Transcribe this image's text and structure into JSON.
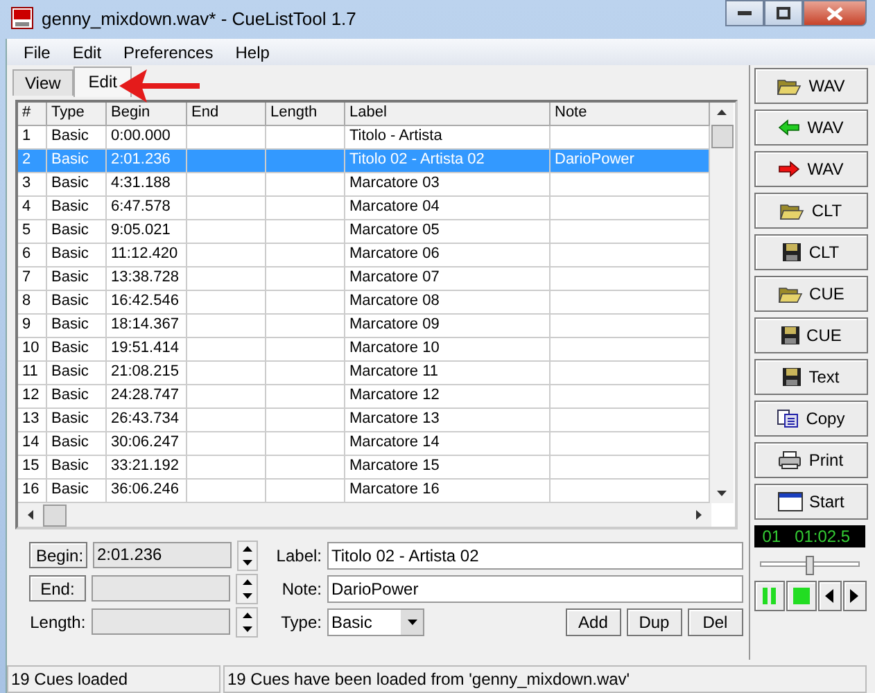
{
  "window": {
    "title": "genny_mixdown.wav* - CueListTool 1.7"
  },
  "menu": [
    "File",
    "Edit",
    "Preferences",
    "Help"
  ],
  "tabs": [
    {
      "label": "View",
      "selected": false
    },
    {
      "label": "Edit",
      "selected": true
    }
  ],
  "table": {
    "columns": [
      "#",
      "Type",
      "Begin",
      "End",
      "Length",
      "Label",
      "Note"
    ],
    "rows": [
      {
        "cells": [
          "1",
          "Basic",
          "0:00.000",
          "",
          "",
          "Titolo - Artista",
          ""
        ],
        "selected": false
      },
      {
        "cells": [
          "2",
          "Basic",
          "2:01.236",
          "",
          "",
          "Titolo 02 - Artista 02",
          "DarioPower"
        ],
        "selected": true
      },
      {
        "cells": [
          "3",
          "Basic",
          "4:31.188",
          "",
          "",
          "Marcatore 03",
          ""
        ],
        "selected": false
      },
      {
        "cells": [
          "4",
          "Basic",
          "6:47.578",
          "",
          "",
          "Marcatore 04",
          ""
        ],
        "selected": false
      },
      {
        "cells": [
          "5",
          "Basic",
          "9:05.021",
          "",
          "",
          "Marcatore 05",
          ""
        ],
        "selected": false
      },
      {
        "cells": [
          "6",
          "Basic",
          "11:12.420",
          "",
          "",
          "Marcatore 06",
          ""
        ],
        "selected": false
      },
      {
        "cells": [
          "7",
          "Basic",
          "13:38.728",
          "",
          "",
          "Marcatore 07",
          ""
        ],
        "selected": false
      },
      {
        "cells": [
          "8",
          "Basic",
          "16:42.546",
          "",
          "",
          "Marcatore 08",
          ""
        ],
        "selected": false
      },
      {
        "cells": [
          "9",
          "Basic",
          "18:14.367",
          "",
          "",
          "Marcatore 09",
          ""
        ],
        "selected": false
      },
      {
        "cells": [
          "10",
          "Basic",
          "19:51.414",
          "",
          "",
          "Marcatore 10",
          ""
        ],
        "selected": false
      },
      {
        "cells": [
          "11",
          "Basic",
          "21:08.215",
          "",
          "",
          "Marcatore 11",
          ""
        ],
        "selected": false
      },
      {
        "cells": [
          "12",
          "Basic",
          "24:28.747",
          "",
          "",
          "Marcatore 12",
          ""
        ],
        "selected": false
      },
      {
        "cells": [
          "13",
          "Basic",
          "26:43.734",
          "",
          "",
          "Marcatore 13",
          ""
        ],
        "selected": false
      },
      {
        "cells": [
          "14",
          "Basic",
          "30:06.247",
          "",
          "",
          "Marcatore 14",
          ""
        ],
        "selected": false
      },
      {
        "cells": [
          "15",
          "Basic",
          "33:21.192",
          "",
          "",
          "Marcatore 15",
          ""
        ],
        "selected": false
      },
      {
        "cells": [
          "16",
          "Basic",
          "36:06.246",
          "",
          "",
          "Marcatore 16",
          ""
        ],
        "selected": false
      }
    ]
  },
  "editor": {
    "begin_button": "Begin:",
    "begin_value": "2:01.236",
    "end_button": "End:",
    "length_label": "Length:",
    "label_label": "Label:",
    "label_value": "Titolo 02 - Artista 02",
    "note_label": "Note:",
    "note_value": "DarioPower",
    "type_label": "Type:",
    "type_value": "Basic",
    "buttons": [
      "Add",
      "Dup",
      "Del"
    ]
  },
  "side_buttons": [
    {
      "kind": "open",
      "label": "WAV"
    },
    {
      "kind": "back",
      "label": "WAV"
    },
    {
      "kind": "forward",
      "label": "WAV"
    },
    {
      "kind": "open",
      "label": "CLT"
    },
    {
      "kind": "save",
      "label": "CLT"
    },
    {
      "kind": "open",
      "label": "CUE"
    },
    {
      "kind": "save",
      "label": "CUE"
    },
    {
      "kind": "save",
      "label": "Text"
    },
    {
      "kind": "copy",
      "label": "Copy"
    },
    {
      "kind": "print",
      "label": "Print"
    },
    {
      "kind": "window",
      "label": "Start"
    }
  ],
  "player": {
    "track": "01",
    "time": "01:02.5",
    "position": {
      "level": 0.5
    }
  },
  "status_bar": [
    "19 Cues loaded",
    "19 Cues have been loaded from 'genny_mixdown.wav'"
  ]
}
